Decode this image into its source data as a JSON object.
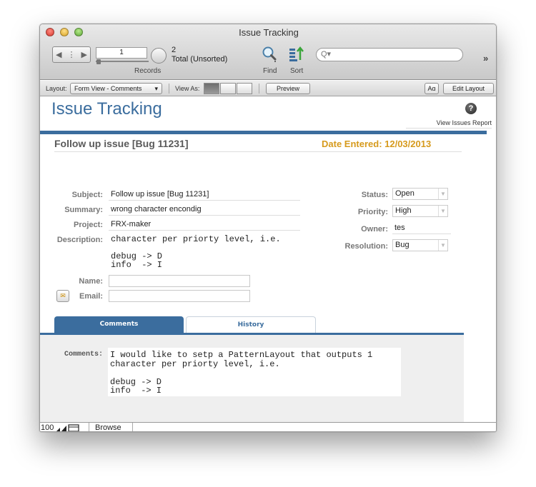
{
  "window": {
    "title": "Issue Tracking"
  },
  "toolbar": {
    "record_current": "1",
    "record_count": "2",
    "record_status": "Total (Unsorted)",
    "records_label": "Records",
    "find_label": "Find",
    "sort_label": "Sort",
    "search_placeholder": "Q▾",
    "overflow": "»"
  },
  "layout_bar": {
    "layout_label": "Layout:",
    "layout_value": "Form View - Comments",
    "view_as_label": "View As:",
    "preview_label": "Preview",
    "font_button": "Aɑ",
    "edit_layout_label": "Edit Layout"
  },
  "header": {
    "app_title": "Issue Tracking",
    "help": "?",
    "report_link": "View Issues Report"
  },
  "issue": {
    "title": "Follow up issue [Bug 11231]",
    "date_entered": "Date Entered: 12/03/2013"
  },
  "fields": {
    "subject_label": "Subject:",
    "subject": "Follow up issue [Bug 11231]",
    "summary_label": "Summary:",
    "summary": "wrong character encondig",
    "project_label": "Project:",
    "project": "FRX-maker",
    "description_label": "Description:",
    "description": "character per priorty level, i.e.\n\ndebug -> D\ninfo  -> I",
    "name_label": "Name:",
    "name": "",
    "email_label": "Email:",
    "email": "",
    "status_label": "Status:",
    "status": "Open",
    "priority_label": "Priority:",
    "priority": "High",
    "owner_label": "Owner:",
    "owner": "tes",
    "resolution_label": "Resolution:",
    "resolution": "Bug"
  },
  "tabs": [
    {
      "label": "Comments",
      "active": true
    },
    {
      "label": "History",
      "active": false
    }
  ],
  "comments": {
    "label": "Comments:",
    "text": "I would like to setp a PatternLayout that outputs 1\ncharacter per priorty level, i.e.\n\ndebug -> D\ninfo  -> I"
  },
  "status_bar": {
    "zoom": "100",
    "mode": "Browse"
  },
  "colors": {
    "brand_blue": "#3b6d9e",
    "date_orange": "#d69a1c"
  }
}
